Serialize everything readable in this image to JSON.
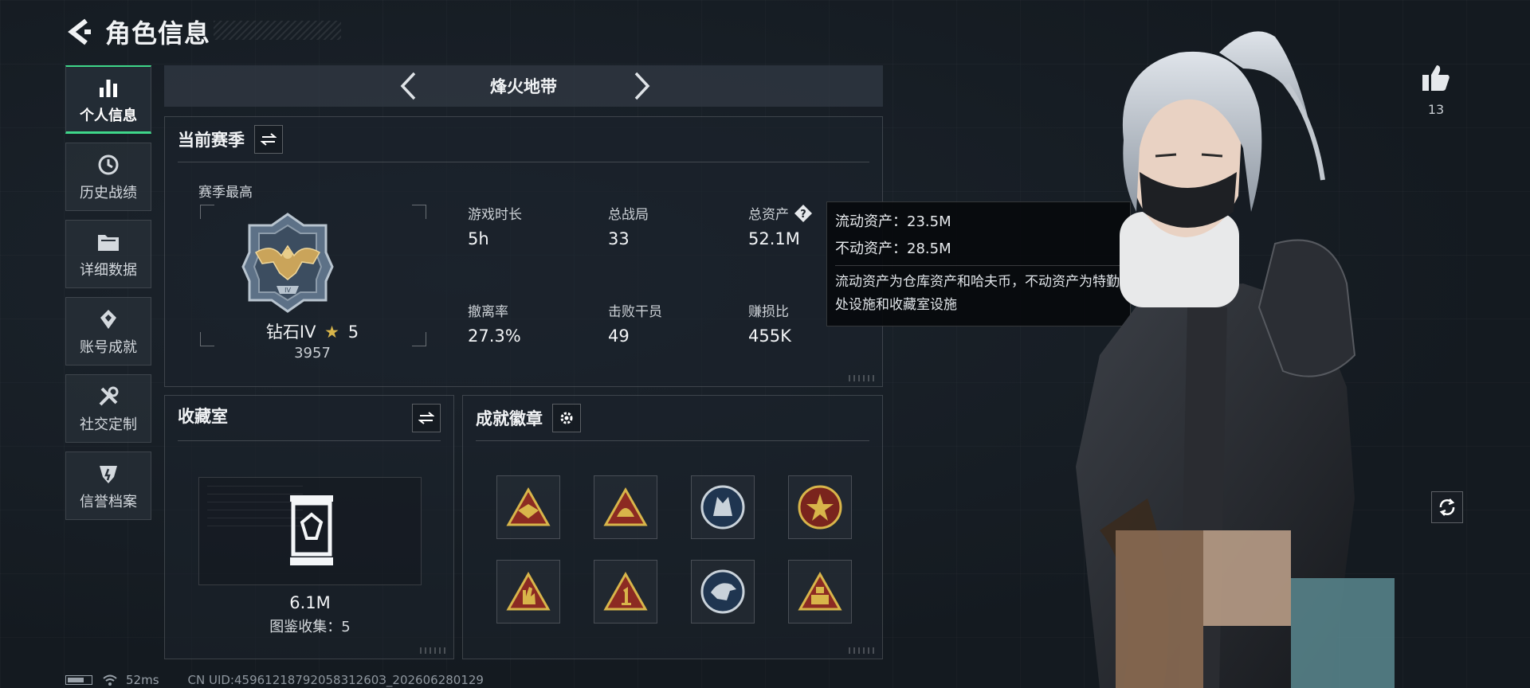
{
  "header": {
    "title": "角色信息",
    "back_icon": "back-arrow-icon"
  },
  "sidebar": {
    "items": [
      {
        "label": "个人信息",
        "icon": "bar-chart-icon",
        "active": true
      },
      {
        "label": "历史战绩",
        "icon": "history-icon",
        "active": false
      },
      {
        "label": "详细数据",
        "icon": "folder-icon",
        "active": false
      },
      {
        "label": "账号成就",
        "icon": "achievement-icon",
        "active": false
      },
      {
        "label": "社交定制",
        "icon": "tools-icon",
        "active": false
      },
      {
        "label": "信誉档案",
        "icon": "credit-shield-icon",
        "active": false
      }
    ]
  },
  "mode": {
    "title": "烽火地带"
  },
  "season": {
    "title": "当前赛季",
    "subtitle": "赛季最高",
    "rank_name": "钻石IV",
    "rank_stars": "5",
    "rank_score": "3957",
    "stats": [
      {
        "label": "游戏时长",
        "value": "5h"
      },
      {
        "label": "总战局",
        "value": "33"
      },
      {
        "label": "总资产",
        "value": "52.1M",
        "help": true
      },
      {
        "label": "撤离率",
        "value": "27.3%"
      },
      {
        "label": "击败干员",
        "value": "49"
      },
      {
        "label": "赚损比",
        "value": "455K"
      }
    ]
  },
  "tooltip": {
    "liquid": "流动资产：23.5M",
    "fixed": "不动资产：28.5M",
    "desc": "流动资产为仓库资产和哈夫币，不动资产为特勤处设施和收藏室设施"
  },
  "collection": {
    "title": "收藏室",
    "value": "6.1M",
    "count_label": "图鉴收集：5"
  },
  "badges": {
    "title": "成就徽章",
    "items": [
      "badge-triangle-eagle",
      "badge-triangle-helmet",
      "badge-round-wolf",
      "badge-round-star",
      "badge-triangle-hand",
      "badge-triangle-one",
      "badge-round-eagle",
      "badge-triangle-tower"
    ]
  },
  "status": {
    "ping": "52ms",
    "uid": "CN UID:4596121879205831260З_202606280129"
  },
  "social": {
    "likes": "13"
  },
  "colors": {
    "accent": "#3fd78a",
    "gold": "#d8b54a",
    "badge_red": "#8c2a22"
  }
}
